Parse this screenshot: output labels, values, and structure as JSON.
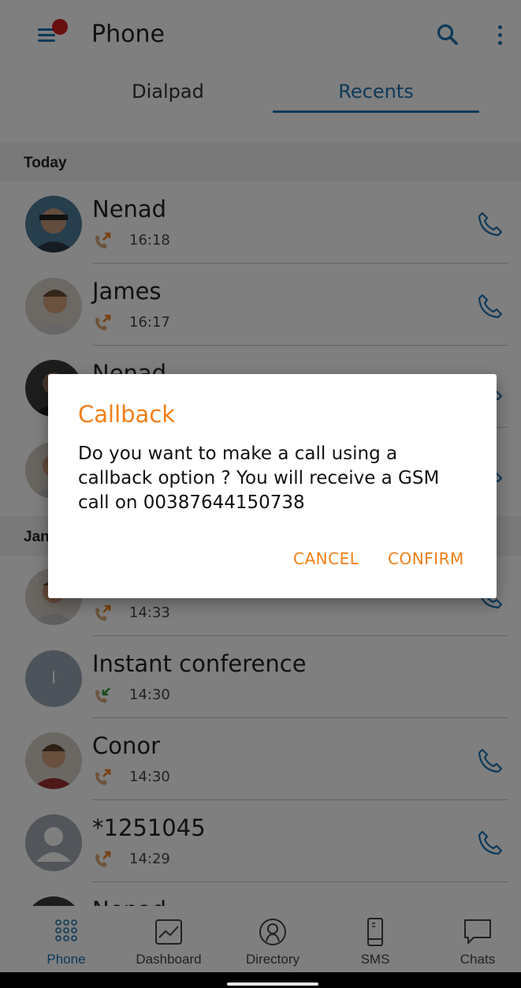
{
  "header": {
    "title": "Phone",
    "menu_icon": "hamburger-menu-icon",
    "notification_color": "#d21f1f",
    "search_icon": "search-icon",
    "more_icon": "more-vertical-icon"
  },
  "tabs": [
    {
      "label": "Dialpad",
      "active": false
    },
    {
      "label": "Recents",
      "active": true
    }
  ],
  "recents": {
    "sections": [
      {
        "label": "Today"
      },
      {
        "label": "Jan"
      }
    ],
    "rows": [
      {
        "name": "Nenad",
        "time": "16:18",
        "direction": "outgoing",
        "avatar": "photo",
        "has_call_button": true
      },
      {
        "name": "James",
        "time": "16:17",
        "direction": "outgoing",
        "avatar": "photo",
        "has_call_button": true
      },
      {
        "name": "Nenad",
        "time": "",
        "direction": "outgoing",
        "avatar": "photo",
        "has_call_button": true
      },
      {
        "name": "",
        "time": "",
        "direction": "outgoing",
        "avatar": "photo",
        "has_call_button": true
      },
      {
        "name": "",
        "time": "14:33",
        "direction": "outgoing",
        "avatar": "photo",
        "has_call_button": true
      },
      {
        "name": "Instant conference",
        "time": "14:30",
        "direction": "incoming",
        "avatar": "initial",
        "avatar_initial": "I",
        "has_call_button": false
      },
      {
        "name": "Conor",
        "time": "14:30",
        "direction": "outgoing",
        "avatar": "photo",
        "has_call_button": true
      },
      {
        "name": "*1251045",
        "time": "14:29",
        "direction": "outgoing",
        "avatar": "placeholder",
        "has_call_button": true
      },
      {
        "name": "Nenad",
        "time": "",
        "direction": "outgoing",
        "avatar": "photo",
        "has_call_button": true
      }
    ]
  },
  "bottom_nav": [
    {
      "label": "Phone",
      "icon": "dialpad-icon",
      "active": true
    },
    {
      "label": "Dashboard",
      "icon": "chart-icon",
      "active": false
    },
    {
      "label": "Directory",
      "icon": "contacts-icon",
      "active": false
    },
    {
      "label": "SMS",
      "icon": "phone-device-icon",
      "active": false
    },
    {
      "label": "Chats",
      "icon": "chat-bubble-icon",
      "active": false
    }
  ],
  "dialog": {
    "title": "Callback",
    "message": "Do you want to make a call using a callback option ? You will receive a GSM call on 00387644150738",
    "cancel_label": "CANCEL",
    "confirm_label": "CONFIRM"
  },
  "colors": {
    "accent": "#1a73b5",
    "dialog_accent": "#f07f18",
    "outgoing_arrow": "#f07f18",
    "incoming_arrow": "#2e9a3c",
    "handset": "#d9a876"
  }
}
